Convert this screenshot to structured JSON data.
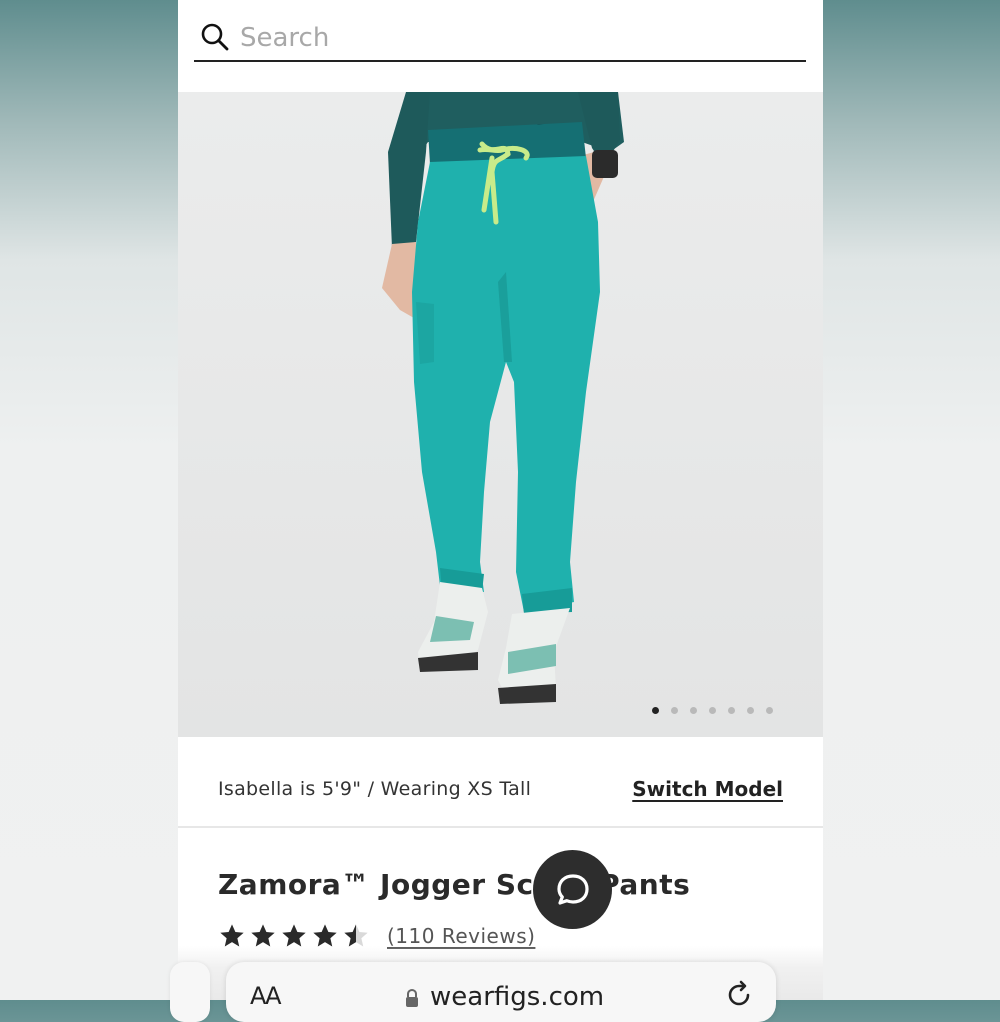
{
  "search": {
    "placeholder": "Search",
    "icon": "search-icon"
  },
  "gallery": {
    "slide_count": 7,
    "active_slide": 1,
    "colors": {
      "pants": "#1fb1ad",
      "waistband": "#156f73",
      "top": "#1f5e5f",
      "drawstring": "#c8eb8a",
      "background": "#e7e8e8"
    }
  },
  "model_info": {
    "text": "Isabella is 5'9\" / Wearing XS Tall",
    "switch_label": "Switch Model"
  },
  "product": {
    "title": "Zamora™ Jogger Scrub Pants",
    "rating": 4.5,
    "rating_max": 5,
    "reviews_label": "(110 Reviews)"
  },
  "chat": {
    "icon": "chat-bubble-icon"
  },
  "browser": {
    "text_size_label": "AA",
    "url": "wearfigs.com",
    "lock_icon": "lock-icon",
    "reload_icon": "reload-icon"
  }
}
